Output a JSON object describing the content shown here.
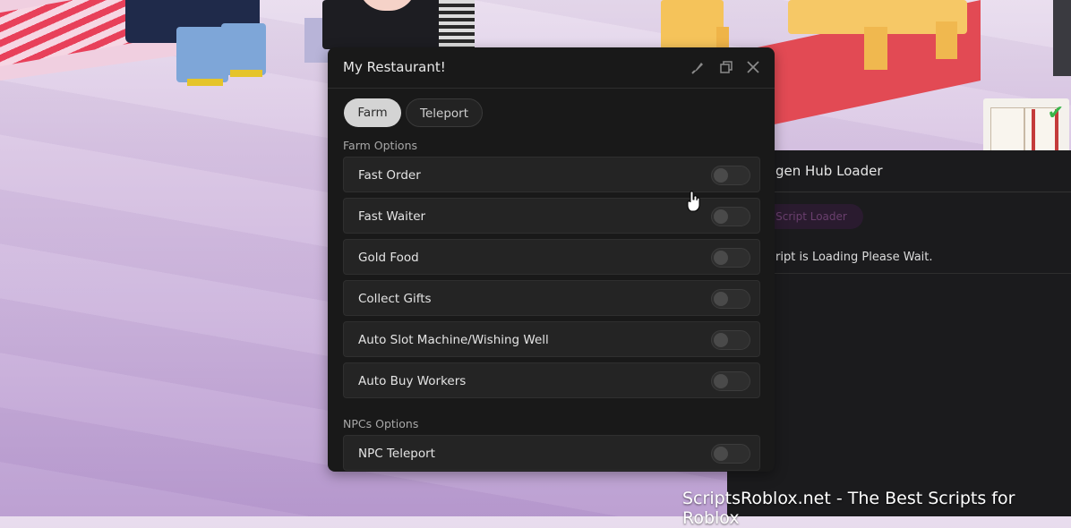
{
  "window": {
    "title": "My Restaurant!",
    "tabs": [
      {
        "label": "Farm",
        "active": true
      },
      {
        "label": "Teleport",
        "active": false
      }
    ],
    "sections": [
      {
        "label": "Farm Options",
        "toggles": [
          {
            "label": "Fast Order",
            "on": false
          },
          {
            "label": "Fast Waiter",
            "on": false
          },
          {
            "label": "Gold Food",
            "on": false
          },
          {
            "label": "Collect Gifts",
            "on": false
          },
          {
            "label": "Auto Slot Machine/Wishing Well",
            "on": false
          },
          {
            "label": "Auto Buy Workers",
            "on": false
          }
        ]
      },
      {
        "label": "NPCs Options",
        "toggles": [
          {
            "label": "NPC Teleport",
            "on": false
          }
        ]
      }
    ],
    "icons": [
      "brush-icon",
      "restore-icon",
      "close-icon"
    ]
  },
  "loader": {
    "title": "gen Hub Loader",
    "tab_label": "Script Loader",
    "message": "ript is Loading Please Wait."
  },
  "watermark": "ScriptsRoblox.net - The Best Scripts for Roblox",
  "colors": {
    "window_bg": "#191919",
    "row_bg": "#242424",
    "tab_active": "#d4d4d4",
    "toggle_off": "#2e2e2e"
  }
}
